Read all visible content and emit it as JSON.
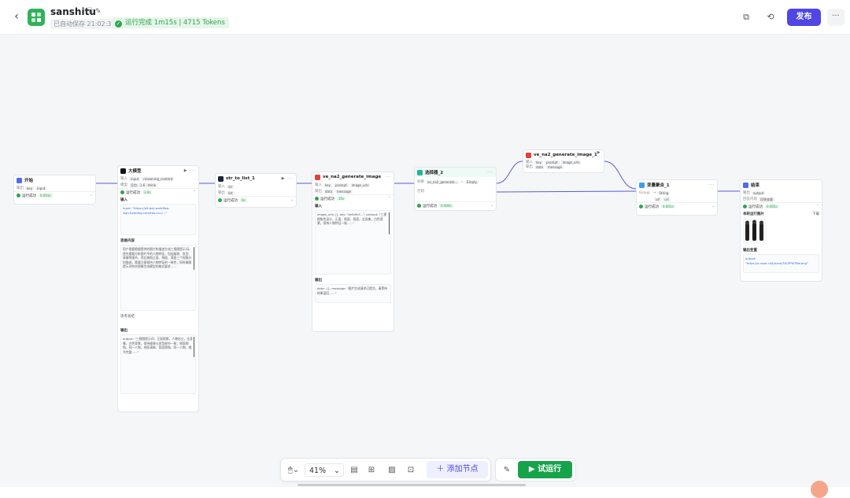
{
  "header": {
    "title": "sanshitu",
    "autosave": "已自动保存 21:02:35",
    "status": "运行完成 1m15s | 4715 Tokens",
    "publish_label": "发布",
    "more_label": "···"
  },
  "colors": {
    "accent": "#4f46e5",
    "success": "#2ea44f",
    "logo": "#32b15b",
    "run": "#16a34a"
  },
  "nodes": {
    "start": {
      "title": "开始",
      "row1": "输出",
      "tag1": "key",
      "tag2": "input",
      "run": "运行成功",
      "time": "0.003s"
    },
    "llm": {
      "title": "大模型",
      "row1": "输入",
      "tag1": "input",
      "tag2": "reasoning_content",
      "row2": "模型",
      "tag3": "豆包 · 1.6 · think",
      "run": "运行成功",
      "time": "3.9s",
      "sec_in": "输入",
      "in_text": "input: \"https://p9-bot-workflow-sign.byteimg.com/tos-cn-i/...\"",
      "sec_think": "思维内容",
      "think_text": "用户需要根据提供的图片和描述生成三视图提示词。首先需要分析图片中的人物特征，包括服装、发型、表情等细节，然后按照正面、侧面、背面三个视角分别描述。需要注意保持人物特征的一致性，同时确保提示词符合图像生成模型的格式要求……",
      "sec_total": "思考总结",
      "sec_out": "输出",
      "out_text": "output: \"三视图提示词：正面视角，人物站立，全身像，白色背景，保持服装与发型细节一致；侧面视角，同一人物，线条清晰；背面视角，同一人物，细节完整……\""
    },
    "str2list": {
      "title": "str_to_list_1",
      "row1": "输入",
      "tag1": "str",
      "row2": "输出",
      "tag2": "list",
      "run": "运行成功",
      "time": "0s"
    },
    "generate": {
      "title": "ve_na2_generate_image",
      "row1": "输入",
      "tag1": "key",
      "tag2": "prompt",
      "tag3": "image_urls",
      "row2": "输出",
      "tag4": "data",
      "tag5": "message",
      "run": "运行成功",
      "time": "35s",
      "sec_in": "输入",
      "in_text": "image_urls: [], key: \"4e5dfc5...\", prompt: \"三视图角色设计，正面、侧面、背面，全身像，白色背景，保持人物特征一致……\"",
      "sec_out": "输出",
      "out_text": "data: {}, message: \"图片生成请求已提交，请等待结果返回……\""
    },
    "selector": {
      "title": "选择器_2",
      "row1": "如果",
      "tag1": "ve_na2_generate...",
      "tag2": "Empty",
      "row2": "否则",
      "run": "运行成功",
      "time": "0.000s"
    },
    "gen2": {
      "title": "ve_na2_generate_image_1",
      "row1": "输入",
      "tag1": "key",
      "tag2": "prompt",
      "tag3": "image_urls",
      "row2": "输出",
      "tag4": "data",
      "tag5": "message"
    },
    "aggregate": {
      "title": "变量聚合_1",
      "row1": "Group",
      "tag1": "String",
      "tag2": "url",
      "tag3": "url",
      "run": "运行成功",
      "time": "0.001s"
    },
    "end": {
      "title": "结束",
      "row1": "输出",
      "tag1": "output",
      "row2": "回答内容",
      "tag2": "回答变量",
      "run": "运行成功",
      "time": "0.005s",
      "sec_img": "本轮运行图片",
      "download": "下载",
      "sec_out": "输出变量",
      "out_text": "output: \"https://s.coze.cn/t/xxxx/3lG3FWT8w.png\""
    }
  },
  "toolbar": {
    "zoom": "41%",
    "add_node": "添加节点",
    "run": "试运行"
  }
}
